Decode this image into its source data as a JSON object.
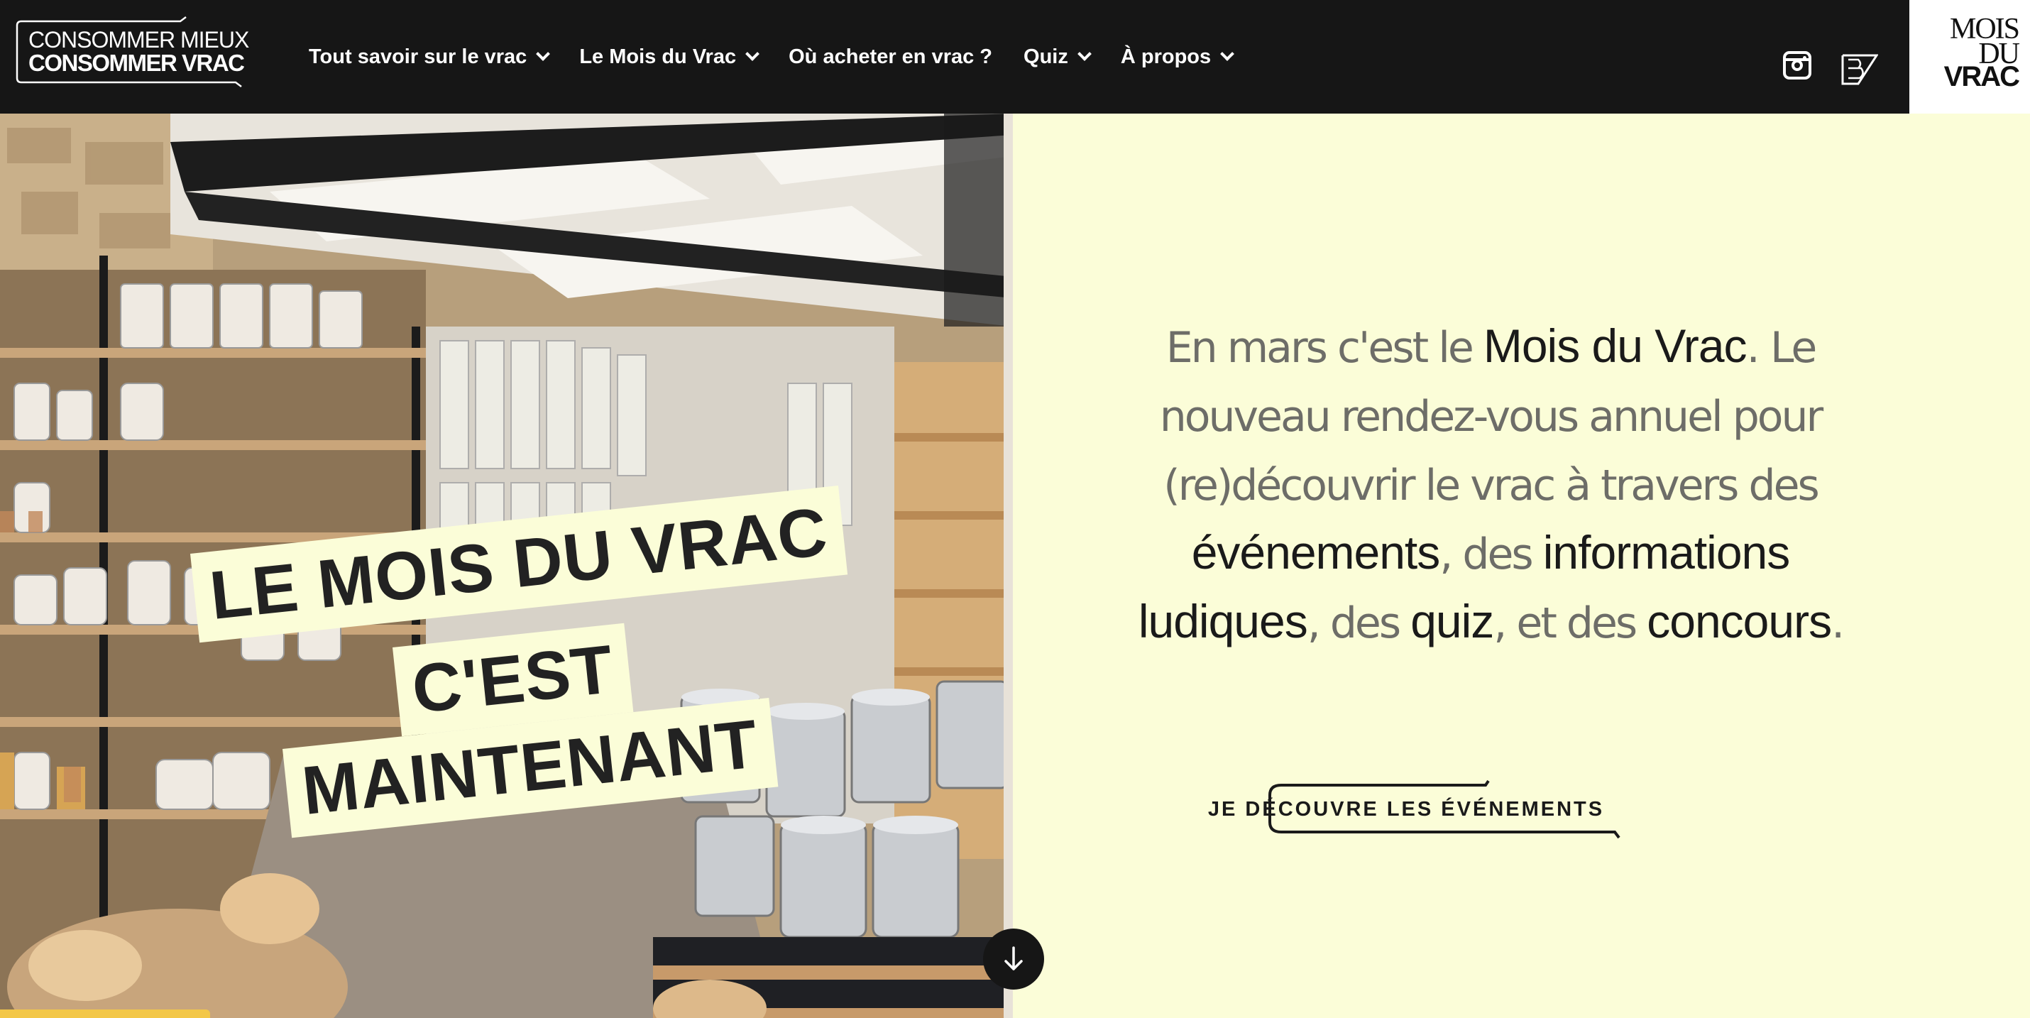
{
  "header": {
    "logo_line1": "CONSOMMER MIEUX",
    "logo_line2": "CONSOMMER VRAC",
    "nav": [
      {
        "label": "Tout savoir sur le vrac",
        "has_dropdown": true
      },
      {
        "label": "Le Mois du Vrac",
        "has_dropdown": true
      },
      {
        "label": "Où acheter en vrac ?",
        "has_dropdown": false
      },
      {
        "label": "Quiz",
        "has_dropdown": true
      },
      {
        "label": "À propos",
        "has_dropdown": true
      }
    ],
    "social_icons": [
      "instagram-icon",
      "brand-icon"
    ],
    "corner_logo": {
      "line1": "MOIS",
      "line2": "DU",
      "line3": "VRAC"
    }
  },
  "hero": {
    "banner_line1": "LE MOIS DU VRAC",
    "banner_line2": "C'EST",
    "banner_line3": "MAINTENANT",
    "scroll_icon": "arrow-down-icon"
  },
  "intro": {
    "p1_light": "En mars c'est le ",
    "p1_strong": "Mois du Vrac",
    "p1_end": ".",
    "p2_light": "Le nouveau rendez-vous annuel pour (re)découvrir le vrac à travers des ",
    "p2_strong1": "événements",
    "p2_sep1": ", des ",
    "p2_strong2": "informations ludiques",
    "p2_sep2": ", des ",
    "p2_strong3": "quiz",
    "p2_sep3": ", et des ",
    "p2_strong4": "concours",
    "p2_end": "."
  },
  "cta": {
    "label": "JE DÉCOUVRE LES ÉVÉNEMENTS"
  },
  "colors": {
    "header_bg": "#161616",
    "page_bg": "#fbfdd8",
    "accent_yellow": "#f3c748"
  }
}
